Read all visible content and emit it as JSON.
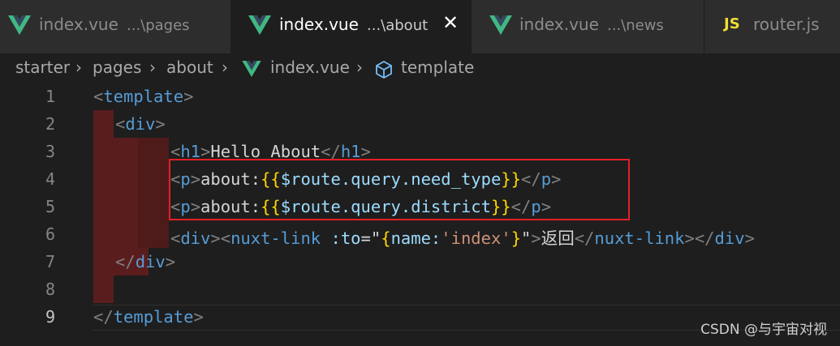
{
  "tabs": [
    {
      "name": "index.vue",
      "path": "...\\pages",
      "icon": "vue-logo-icon",
      "active": false
    },
    {
      "name": "index.vue",
      "path": "...\\about",
      "icon": "vue-logo-icon",
      "active": true
    },
    {
      "name": "index.vue",
      "path": "...\\news",
      "icon": "vue-logo-icon",
      "active": false
    },
    {
      "name": "router.js",
      "path": "",
      "icon": "js-icon",
      "icon_text": "JS",
      "active": false
    }
  ],
  "close_glyph": "✕",
  "breadcrumb": [
    "starter",
    "pages",
    "about",
    "index.vue",
    "template"
  ],
  "breadcrumb_separator": "›",
  "line_numbers": [
    "1",
    "2",
    "3",
    "4",
    "5",
    "6",
    "7",
    "8",
    "9"
  ],
  "active_line": 9,
  "code": {
    "l1_open": "<",
    "l1_tag": "template",
    "l1_close": ">",
    "l2_open": "<",
    "l2_tag": "div",
    "l2_close": ">",
    "l3_open": "<",
    "l3_tag": "h1",
    "l3_close": ">",
    "l3_text": "Hello About",
    "l3_end_open": "</",
    "l3_end_tag": "h1",
    "l3_end_close": ">",
    "l4_open": "<",
    "l4_tag": "p",
    "l4_close": ">",
    "l4_text": "about:",
    "l4_brace_open": "{{",
    "l4_expr": "$route.query.need_type",
    "l4_brace_close": "}}",
    "l4_end_open": "</",
    "l4_end_tag": "p",
    "l4_end_close": ">",
    "l5_open": "<",
    "l5_tag": "p",
    "l5_close": ">",
    "l5_text": "about:",
    "l5_brace_open": "{{",
    "l5_expr": "$route.query.district",
    "l5_brace_close": "}}",
    "l5_end_open": "</",
    "l5_end_tag": "p",
    "l5_end_close": ">",
    "l6_open": "<",
    "l6_tag": "div",
    "l6_mid": "><",
    "l6_tag2": "nuxt-link",
    "l6_attr": " :to",
    "l6_eq": "=\"",
    "l6_brace_open": "{",
    "l6_key": "name:",
    "l6_value": "'index'",
    "l6_brace_close": "}",
    "l6_quote": "\"",
    "l6_close": ">",
    "l6_text": "返回",
    "l6_end_open": "</",
    "l6_end_tag": "nuxt-link",
    "l6_end_mid": "></",
    "l6_end_tag2": "div",
    "l6_end_close": ">",
    "l7_open": "</",
    "l7_tag": "div",
    "l7_close": ">",
    "l9_open": "</",
    "l9_tag": "template",
    "l9_close": ">"
  },
  "colors": {
    "highlight_box": "#e41f27",
    "indent_guide_error": "#5a1d1d",
    "tag_name": "#569cd6",
    "attribute": "#9cdcfe",
    "string": "#ce9178",
    "bracket": "#ffd700"
  },
  "watermark": "CSDN @与宇宙对视"
}
